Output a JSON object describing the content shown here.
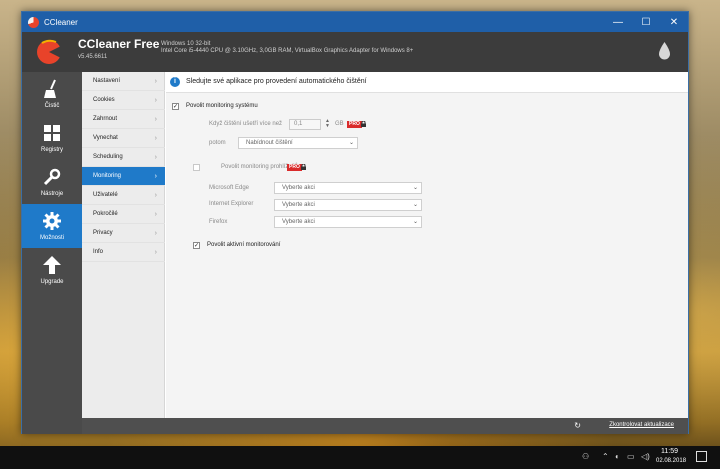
{
  "window": {
    "title": "CCleaner",
    "controls": {
      "minimize": "—",
      "maximize": "☐",
      "close": "✕"
    }
  },
  "header": {
    "product_name": "CCleaner Free",
    "version": "v5.45.6611",
    "sysinfo_line1": "Windows 10 32-bit",
    "sysinfo_line2": "Intel Core i5-4440 CPU @ 3.10GHz, 3,0GB RAM, VirtualBox Graphics Adapter for Windows 8+"
  },
  "leftnav": [
    {
      "label": "Čistič",
      "icon": "broom-icon"
    },
    {
      "label": "Registry",
      "icon": "grid-icon"
    },
    {
      "label": "Nástroje",
      "icon": "wrench-icon"
    },
    {
      "label": "Možnosti",
      "icon": "gear-icon",
      "active": true
    },
    {
      "label": "Upgrade",
      "icon": "arrow-up-icon"
    }
  ],
  "submenu": [
    {
      "label": "Nastavení"
    },
    {
      "label": "Cookies"
    },
    {
      "label": "Zahrnout"
    },
    {
      "label": "Vynechat"
    },
    {
      "label": "Scheduling"
    },
    {
      "label": "Monitoring",
      "active": true
    },
    {
      "label": "Uživatelé"
    },
    {
      "label": "Pokročilé"
    },
    {
      "label": "Privacy"
    },
    {
      "label": "Info"
    }
  ],
  "content": {
    "info_text": "Sledujte své aplikace pro provedení automatického čištění",
    "system_monitoring": {
      "label": "Povolit monitoring systému",
      "checked": true,
      "threshold_label": "Když čištění ušetří více než",
      "threshold_value": "0,1",
      "threshold_unit": "GB",
      "pro_badge": "PRO",
      "then_label": "potom",
      "then_value": "Nabídnout čištění"
    },
    "browser_monitoring": {
      "label": "Povolit monitoring prohlížečů",
      "checked": false,
      "pro_badge": "PRO",
      "browsers": [
        {
          "name": "Microsoft Edge",
          "value": "Vyberte akci"
        },
        {
          "name": "Internet Explorer",
          "value": "Vyberte akci"
        },
        {
          "name": "Firefox",
          "value": "Vyberte akci"
        }
      ]
    },
    "active_monitoring": {
      "label": "Povolit aktivní monitorování",
      "checked": true
    }
  },
  "footer": {
    "update_link": "Zkontrolovat aktualizace"
  },
  "taskbar": {
    "time": "11:59",
    "date": "02.08.2018"
  },
  "colors": {
    "accent": "#1f7ac9",
    "header": "#3c3c3c",
    "nav": "#4a4a4a",
    "pro": "#d92b2b"
  }
}
